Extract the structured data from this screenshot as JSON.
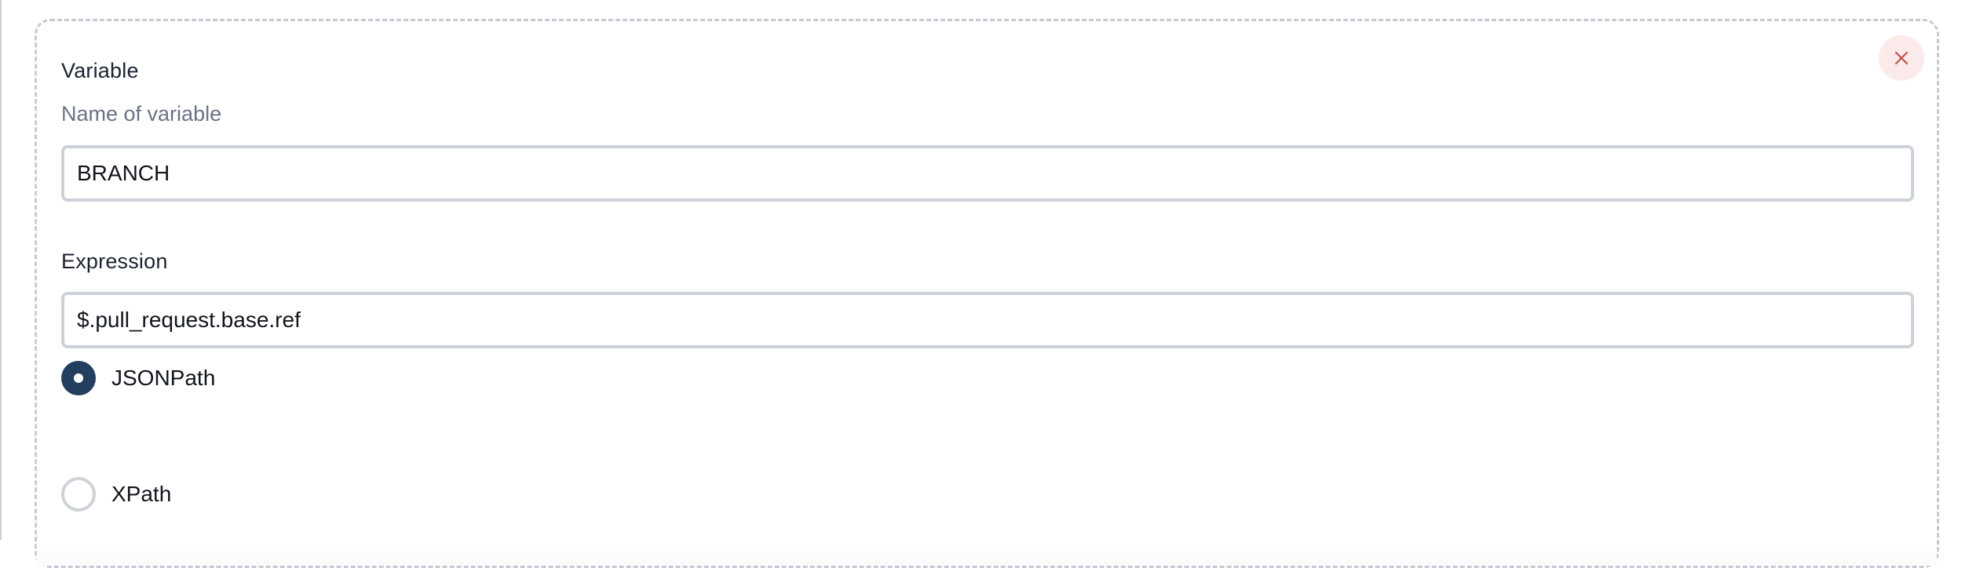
{
  "variable": {
    "label": "Variable",
    "help": "Name of variable",
    "value": "BRANCH"
  },
  "expression": {
    "label": "Expression",
    "value": "$.pull_request.base.ref"
  },
  "type_options": [
    {
      "label": "JSONPath",
      "checked": true
    },
    {
      "label": "XPath",
      "checked": false
    }
  ],
  "close_button": {
    "icon": "close-icon",
    "color": "#c0504d",
    "background": "#fbeaea"
  },
  "colors": {
    "radio_checked": "#243e5f",
    "border": "#cdd2d8",
    "muted_text": "#6b7385"
  }
}
